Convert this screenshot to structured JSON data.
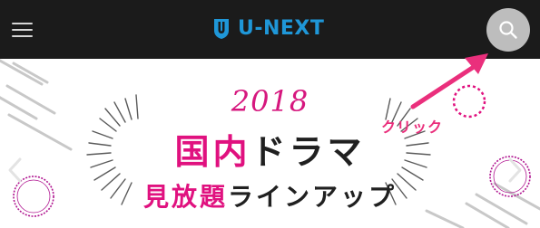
{
  "header": {
    "menu_icon": "hamburger-menu-icon",
    "logo_text": "U-NEXT",
    "logo_icon": "u-next-shield-icon",
    "search_icon": "search-icon"
  },
  "banner": {
    "year": "2018",
    "title_part1": "国内",
    "title_part2": "ドラマ",
    "subtitle_part1": "見放題",
    "subtitle_part2": "ラインアップ",
    "prev_icon": "chevron-left-icon",
    "next_icon": "chevron-right-icon"
  },
  "annotation": {
    "label": "クリック"
  },
  "colors": {
    "header_bg": "#1b1b1b",
    "brand": "#1f97d8",
    "magenta": "#e0117f",
    "annotation": "#ea2f7c",
    "search_button_bg": "#bdbdbd"
  }
}
